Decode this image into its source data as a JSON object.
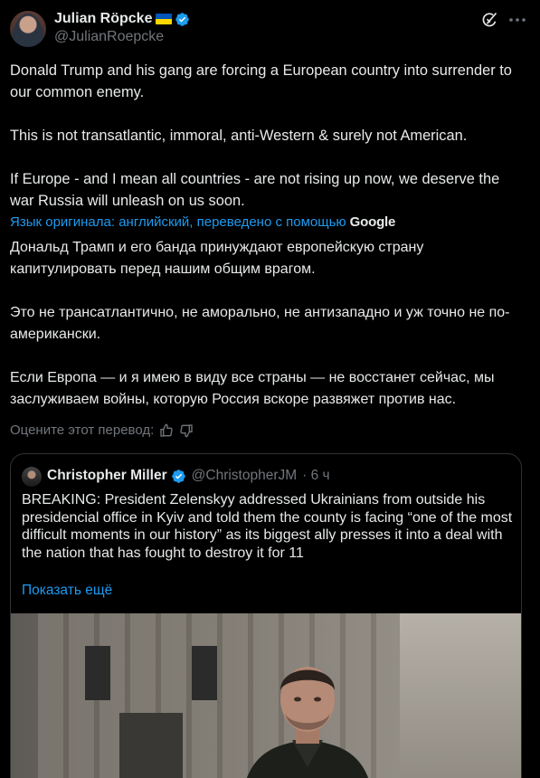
{
  "author": {
    "name": "Julian Röpcke",
    "handle": "@JulianRoepcke"
  },
  "post": {
    "paragraphs": [
      "Donald Trump and his gang are forcing a European country into surrender to our common enemy.",
      "This is not transatlantic, immoral, anti-Western & surely not American.",
      "If Europe - and I mean all countries - are not rising up now, we deserve the war Russia will unleash on us soon."
    ]
  },
  "translation": {
    "notice": "Язык оригинала: английский, переведено с помощью",
    "provider": "Google",
    "paragraphs": [
      "Дональд Трамп и его банда принуждают европейскую страну капитулировать перед нашим общим врагом.",
      "Это не трансатлантично, не аморально, не антизападно и уж точно не по-американски.",
      "Если Европа — и я имею в виду все страны — не восстанет сейчас, мы заслуживаем войны, которую Россия вскоре развяжет против нас."
    ],
    "rate_label": "Оцените этот перевод:"
  },
  "quote": {
    "name": "Christopher Miller",
    "handle": "@ChristopherJM",
    "time": "· 6 ч",
    "text": "BREAKING: President Zelenskyy addressed Ukrainians from outside his presidencial office in Kyiv and told them the county is facing “one of the most difficult moments in our history” as its biggest ally presses it into a deal with the nation that has fought to destroy it for 11",
    "show_more": "Показать ещё"
  },
  "colors": {
    "background": "#000000",
    "text": "#e7e9ea",
    "muted": "#71767b",
    "accent": "#1d9bf0",
    "border": "#2f3336"
  },
  "icons": [
    "verified-icon",
    "grok-icon",
    "more-icon",
    "thumbs-up-icon",
    "thumbs-down-icon"
  ]
}
